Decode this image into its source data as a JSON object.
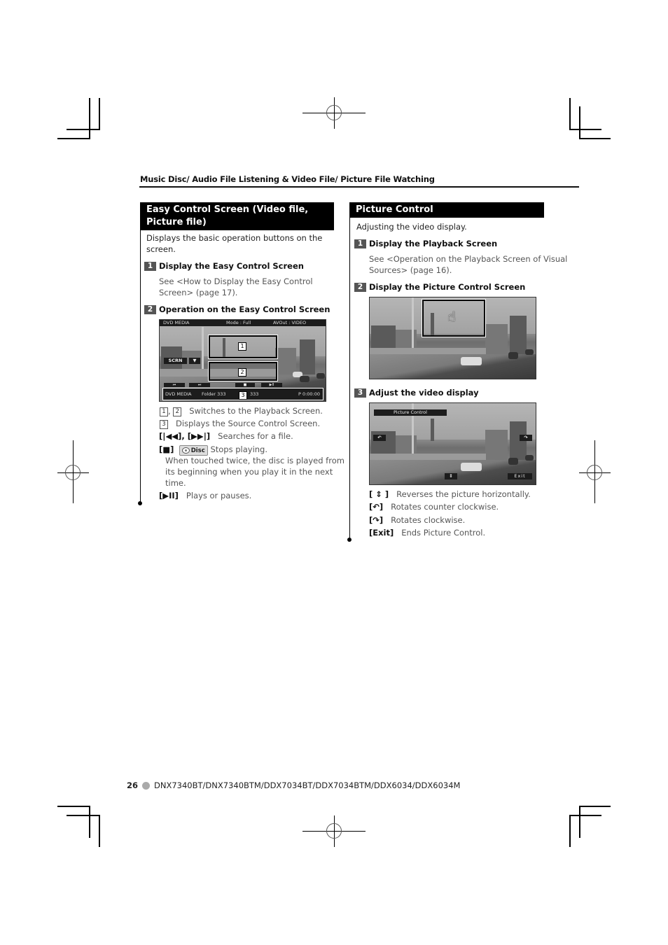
{
  "running_head": "Music Disc/ Audio File Listening & Video File/ Picture File Watching",
  "left": {
    "title": "Easy Control Screen (Video file, Picture file)",
    "intro": "Displays the basic operation buttons on the screen.",
    "steps": [
      {
        "num": "1",
        "title": "Display the Easy Control Screen",
        "text": "See <How to Display the Easy Control Screen> (page 17)."
      },
      {
        "num": "2",
        "title": "Operation on the Easy Control Screen"
      }
    ],
    "screen": {
      "top_bar": {
        "source": "DVD MEDIA",
        "mode": "Mode : Full",
        "avout": "AVOut : VIDEO"
      },
      "scrn_button": "SCRN",
      "scrn_arrow": "▼",
      "regions": [
        "1",
        "2",
        "3"
      ],
      "buttons": {
        "prev": "⏮",
        "next": "⏭",
        "stop": "■",
        "playpause": "▶II"
      },
      "source_bar": {
        "source": "DVD MEDIA",
        "folder": "Folder 333",
        "file": "333",
        "time": "P   0:00:00"
      }
    },
    "descriptions": [
      {
        "keys": [
          "1",
          "2"
        ],
        "text": "Switches to the Playback Screen."
      },
      {
        "keys": [
          "3"
        ],
        "text": "Displays the Source Control Screen."
      },
      {
        "label": "[|◀◀], [▶▶|]",
        "text": "Searches for a file."
      },
      {
        "label": "[■]",
        "badge": "Disc",
        "text": "Stops playing.",
        "note_lines": [
          "When touched twice, the disc is played from",
          "its beginning when you play it in the next",
          "time."
        ]
      },
      {
        "label": "[▶II]",
        "text": "Plays or pauses."
      }
    ]
  },
  "right": {
    "title": "Picture Control",
    "intro": "Adjusting the video display.",
    "steps": [
      {
        "num": "1",
        "title": "Display the Playback Screen",
        "text_lines": [
          "See <Operation on the Playback Screen of Visual",
          "Sources> (page 16)."
        ]
      },
      {
        "num": "2",
        "title": "Display the Picture Control Screen"
      },
      {
        "num": "3",
        "title": "Adjust the video display"
      }
    ],
    "screen2": {
      "pointer": "☝"
    },
    "screen3": {
      "title_bar": "Picture Control",
      "ccw": "↶",
      "cw": "↷",
      "flip": "⇕",
      "exit": "Exit"
    },
    "descriptions": [
      {
        "label": "[ ⇕ ]",
        "text": "Reverses the picture horizontally."
      },
      {
        "label": "[↶]",
        "text": "Rotates counter clockwise."
      },
      {
        "label": "[↷]",
        "text": "Rotates clockwise."
      },
      {
        "label": "[Exit]",
        "text": "Ends Picture Control."
      }
    ]
  },
  "footer": {
    "page_number": "26",
    "models": "DNX7340BT/DNX7340BTM/DDX7034BT/DDX7034BTM/DDX6034/DDX6034M"
  }
}
